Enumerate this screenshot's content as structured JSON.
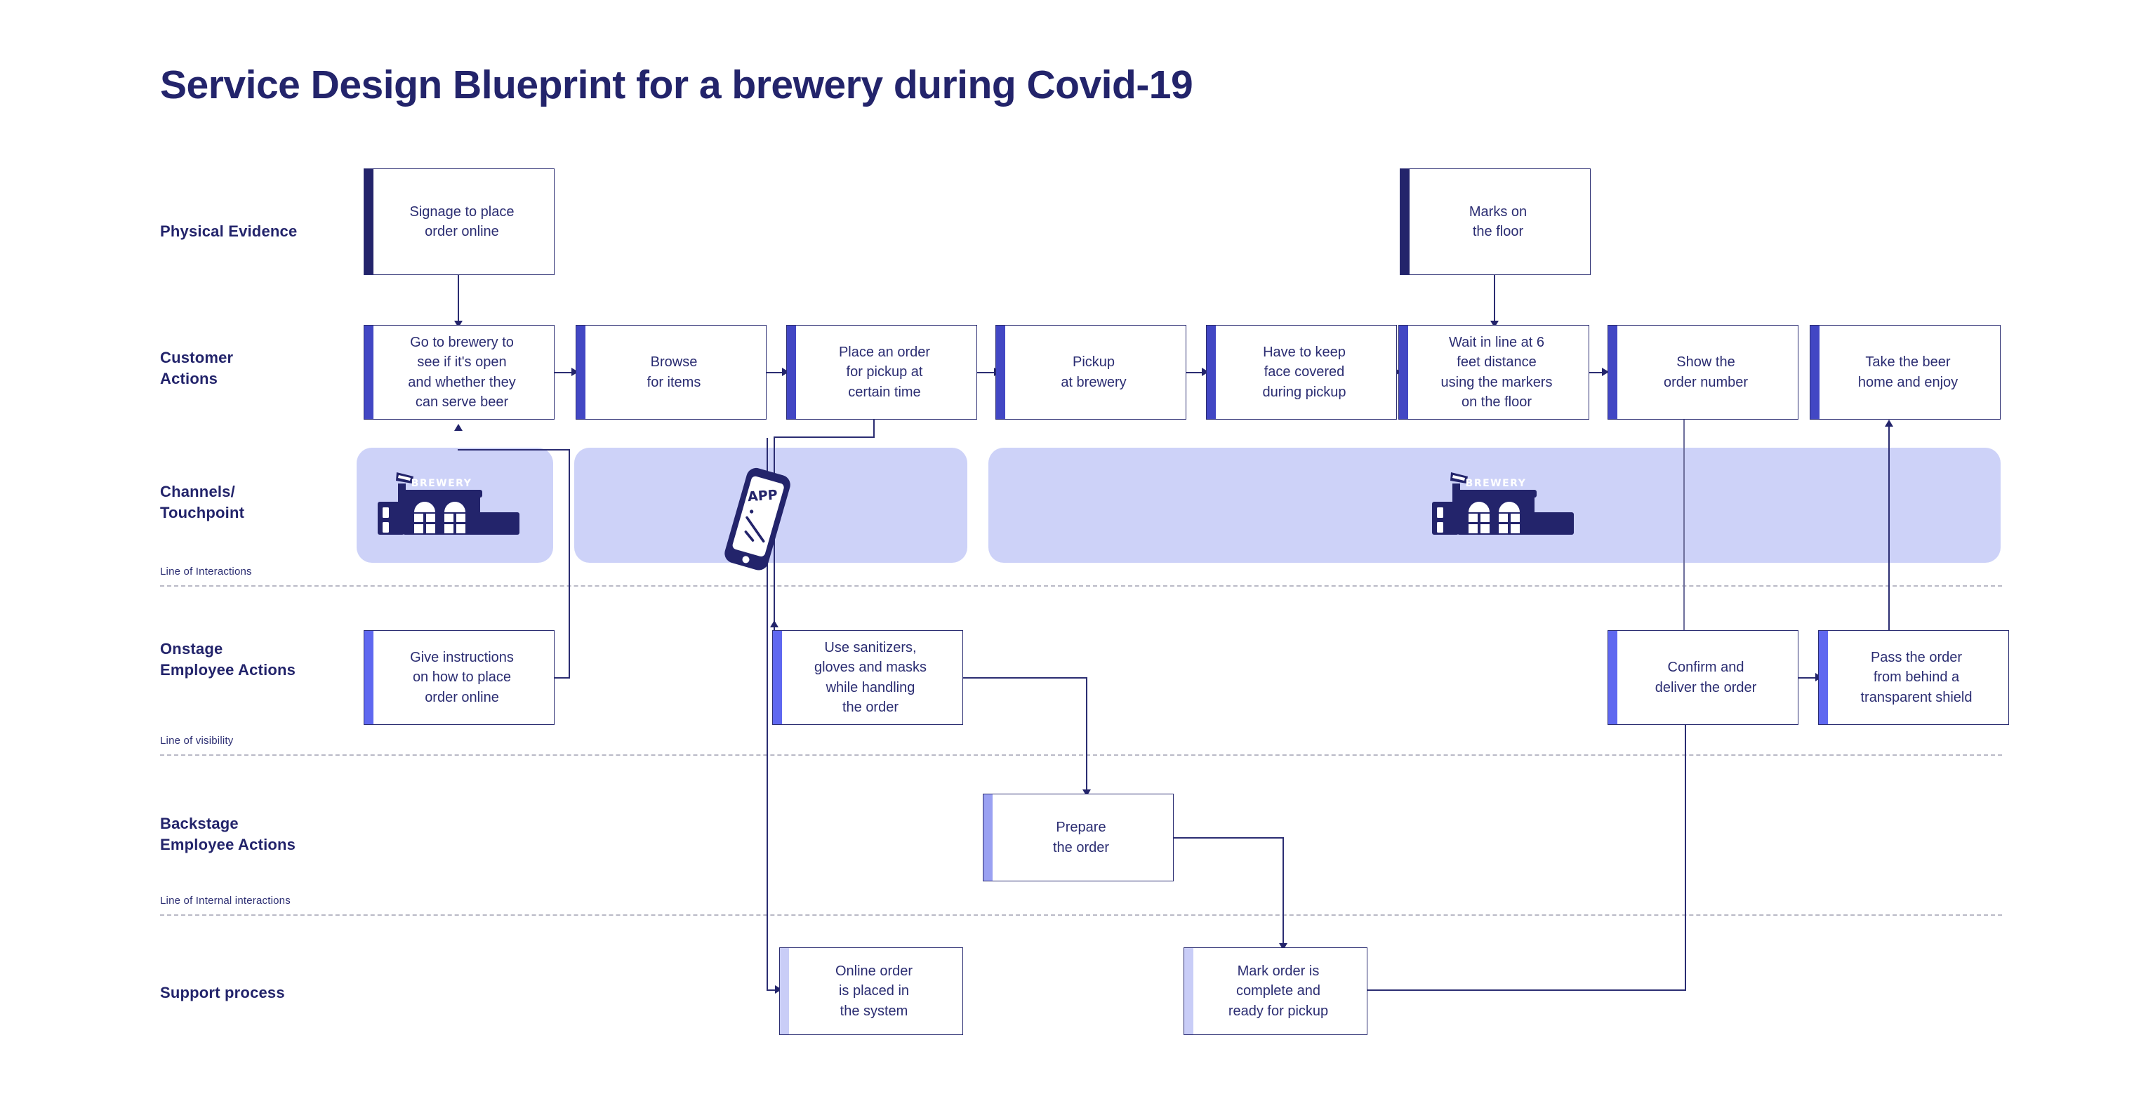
{
  "page": {
    "title": "Service Design Blueprint for a brewery during Covid-19"
  },
  "rows": [
    {
      "key": "physical_evidence",
      "label": "Physical Evidence"
    },
    {
      "key": "customer_actions",
      "label": "Customer\nActions"
    },
    {
      "key": "channels_touchpoint",
      "label": "Channels/\nTouchpoint"
    },
    {
      "key": "onstage_employee_actions",
      "label": "Onstage\nEmployee Actions"
    },
    {
      "key": "backstage_employee_actions",
      "label": "Backstage\nEmployee Actions"
    },
    {
      "key": "support_process",
      "label": "Support process"
    }
  ],
  "dividers": [
    {
      "key": "line_of_interactions",
      "label": "Line of Interactions"
    },
    {
      "key": "line_of_visibility",
      "label": "Line of visibility"
    },
    {
      "key": "line_of_internal_interactions",
      "label": "Line of Internal interactions"
    }
  ],
  "physical_evidence": [
    {
      "id": "pe1",
      "text": "Signage to place\norder online"
    },
    {
      "id": "pe2",
      "text": "Marks on\nthe floor"
    }
  ],
  "customer_actions": [
    {
      "id": "ca1",
      "text": "Go to brewery to\nsee if it's open\nand whether they\ncan serve beer"
    },
    {
      "id": "ca2",
      "text": "Browse\nfor items"
    },
    {
      "id": "ca3",
      "text": "Place an order\nfor pickup at\ncertain time"
    },
    {
      "id": "ca4",
      "text": "Pickup\nat brewery"
    },
    {
      "id": "ca5",
      "text": "Have to keep\nface covered\nduring pickup"
    },
    {
      "id": "ca6",
      "text": "Wait in line at 6\nfeet distance\nusing the markers\non the floor"
    },
    {
      "id": "ca7",
      "text": "Show the\norder number"
    },
    {
      "id": "ca8",
      "text": "Take the beer\nhome and enjoy"
    }
  ],
  "channels_touchpoint": [
    {
      "id": "ch1",
      "icon": "brewery-building-icon",
      "icon_label": "BREWERY"
    },
    {
      "id": "ch2",
      "icon": "mobile-app-phone-icon",
      "icon_label": "APP"
    },
    {
      "id": "ch3",
      "icon": "brewery-building-icon",
      "icon_label": "BREWERY"
    }
  ],
  "onstage_employee_actions": [
    {
      "id": "oe1",
      "text": "Give instructions\non how to place\norder online"
    },
    {
      "id": "oe2",
      "text": "Use sanitizers,\ngloves and masks\nwhile handling\nthe order"
    },
    {
      "id": "oe3",
      "text": "Confirm and\ndeliver the order"
    },
    {
      "id": "oe4",
      "text": "Pass the order\nfrom behind a\ntransparent shield"
    }
  ],
  "backstage_employee_actions": [
    {
      "id": "be1",
      "text": "Prepare\nthe order"
    }
  ],
  "support_process": [
    {
      "id": "sp1",
      "text": "Online order\nis placed in\nthe system"
    },
    {
      "id": "sp2",
      "text": "Mark order is\ncomplete and\nready for pickup"
    }
  ],
  "colors": {
    "title": "#23246b",
    "text": "#2b2d72",
    "accent_dark": "#23246b",
    "accent_blue": "#4247c4",
    "accent_mid": "#5f68f0",
    "accent_light": "#9aa1f2",
    "accent_pale": "#c9cdf7",
    "band": "#cdd2f8",
    "divider": "#b9b9c6",
    "background": "#ffffff"
  }
}
